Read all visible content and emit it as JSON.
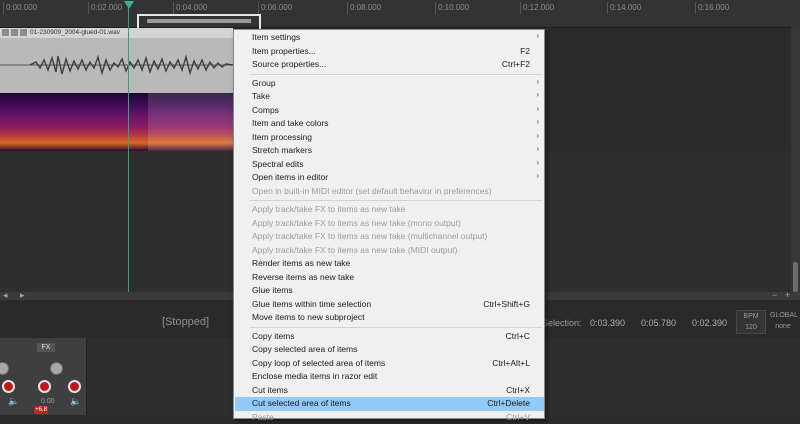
{
  "timeline": {
    "ticks": [
      "0:00.000",
      "0:02.000",
      "0:04.000",
      "0:06.000",
      "0:08.000",
      "0:10.000",
      "0:12.000",
      "0:14.000",
      "0:16.000"
    ]
  },
  "item": {
    "name": "01-230909_2004-glued-01.wav"
  },
  "transport": {
    "status": "[Stopped]",
    "selection_label": "Selection:",
    "sel_start": "0:03.390",
    "sel_end": "0:05.780",
    "sel_length": "0:02.390",
    "bpm_label": "BPM",
    "bpm": "120",
    "ts_label": "GLOBAL",
    "ts_value": "none"
  },
  "mixer": {
    "fx_label": "FX",
    "vol1": "0.00",
    "peak": "+6.8"
  },
  "menu": {
    "items": [
      {
        "label": "Item settings",
        "shortcut": "",
        "submenu": true,
        "disabled": false
      },
      {
        "label": "Item properties...",
        "shortcut": "F2",
        "submenu": false,
        "disabled": false
      },
      {
        "label": "Source properties...",
        "shortcut": "Ctrl+F2",
        "submenu": false,
        "disabled": false
      },
      {
        "label": "Group",
        "shortcut": "",
        "submenu": true,
        "disabled": false
      },
      {
        "label": "Take",
        "shortcut": "",
        "submenu": true,
        "disabled": false
      },
      {
        "label": "Comps",
        "shortcut": "",
        "submenu": true,
        "disabled": false
      },
      {
        "label": "Item and take colors",
        "shortcut": "",
        "submenu": true,
        "disabled": false
      },
      {
        "label": "Item processing",
        "shortcut": "",
        "submenu": true,
        "disabled": false
      },
      {
        "label": "Stretch markers",
        "shortcut": "",
        "submenu": true,
        "disabled": false
      },
      {
        "label": "Spectral edits",
        "shortcut": "",
        "submenu": true,
        "disabled": false
      },
      {
        "label": "Open items in editor",
        "shortcut": "",
        "submenu": true,
        "disabled": false
      },
      {
        "label": "Open in built-in MIDI editor (set default behavior in preferences)",
        "shortcut": "",
        "submenu": false,
        "disabled": true
      },
      {
        "label": "Apply track/take FX to items as new take",
        "shortcut": "",
        "submenu": false,
        "disabled": true
      },
      {
        "label": "Apply track/take FX to items as new take (mono output)",
        "shortcut": "",
        "submenu": false,
        "disabled": true
      },
      {
        "label": "Apply track/take FX to items as new take (multichannel output)",
        "shortcut": "",
        "submenu": false,
        "disabled": true
      },
      {
        "label": "Apply track/take FX to items as new take (MIDI output)",
        "shortcut": "",
        "submenu": false,
        "disabled": true
      },
      {
        "label": "Render items as new take",
        "shortcut": "",
        "submenu": false,
        "disabled": false
      },
      {
        "label": "Reverse items as new take",
        "shortcut": "",
        "submenu": false,
        "disabled": false
      },
      {
        "label": "Glue items",
        "shortcut": "",
        "submenu": false,
        "disabled": false
      },
      {
        "label": "Glue items within time selection",
        "shortcut": "Ctrl+Shift+G",
        "submenu": false,
        "disabled": false
      },
      {
        "label": "Move items to new subproject",
        "shortcut": "",
        "submenu": false,
        "disabled": false
      },
      {
        "label": "Copy items",
        "shortcut": "Ctrl+C",
        "submenu": false,
        "disabled": false
      },
      {
        "label": "Copy selected area of items",
        "shortcut": "",
        "submenu": false,
        "disabled": false
      },
      {
        "label": "Copy loop of selected area of items",
        "shortcut": "Ctrl+Alt+L",
        "submenu": false,
        "disabled": false
      },
      {
        "label": "Enclose media items in razor edit",
        "shortcut": "",
        "submenu": false,
        "disabled": false
      },
      {
        "label": "Cut items",
        "shortcut": "Ctrl+X",
        "submenu": false,
        "disabled": false
      },
      {
        "label": "Cut selected area of items",
        "shortcut": "Ctrl+Delete",
        "submenu": false,
        "disabled": false,
        "highlighted": true
      },
      {
        "label": "Paste",
        "shortcut": "Ctrl+V",
        "submenu": false,
        "disabled": true
      }
    ]
  }
}
